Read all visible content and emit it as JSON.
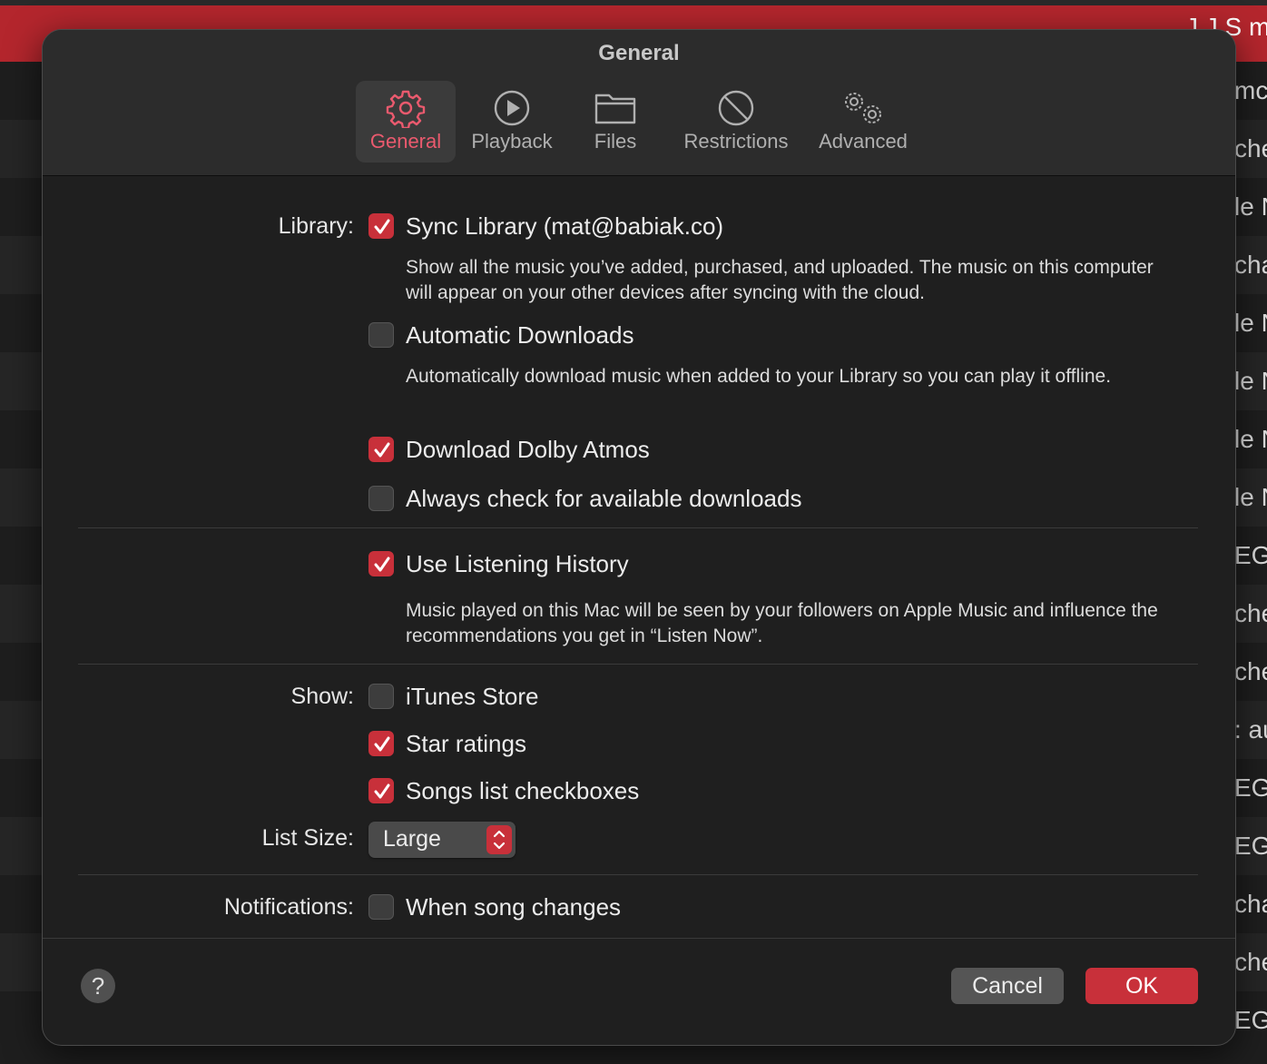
{
  "background": {
    "top_right_text": "J.J.S mo",
    "row_fragments": [
      "mc",
      "che",
      "le N",
      "cha",
      "le N",
      "le N",
      "le N",
      "le N",
      "EG .",
      "che",
      "che",
      ": au",
      "EG .",
      "EG .",
      "cha",
      "che",
      "EG ."
    ]
  },
  "dialog": {
    "title": "General",
    "tabs": [
      {
        "label": "General",
        "icon": "gear-icon",
        "selected": true
      },
      {
        "label": "Playback",
        "icon": "play-circle-icon",
        "selected": false
      },
      {
        "label": "Files",
        "icon": "folder-icon",
        "selected": false
      },
      {
        "label": "Restrictions",
        "icon": "restricted-icon",
        "selected": false
      },
      {
        "label": "Advanced",
        "icon": "gears-icon",
        "selected": false
      }
    ],
    "library": {
      "label": "Library:",
      "sync_library": {
        "label": "Sync Library (mat@babiak.co)",
        "checked": true
      },
      "sync_library_desc": "Show all the music you’ve added, purchased, and uploaded. The music on this computer will appear on your other devices after syncing with the cloud.",
      "automatic_downloads": {
        "label": "Automatic Downloads",
        "checked": false
      },
      "automatic_downloads_desc": "Automatically download music when added to your Library so you can play it offline.",
      "dolby_atmos": {
        "label": "Download Dolby Atmos",
        "checked": true
      },
      "always_check": {
        "label": "Always check for available downloads",
        "checked": false
      }
    },
    "listening_history": {
      "option": {
        "label": "Use Listening History",
        "checked": true
      },
      "desc": "Music played on this Mac will be seen by your followers on Apple Music and influence the recommendations you get in “Listen Now”."
    },
    "show": {
      "label": "Show:",
      "itunes_store": {
        "label": "iTunes Store",
        "checked": false
      },
      "star_ratings": {
        "label": "Star ratings",
        "checked": true
      },
      "songs_checkboxes": {
        "label": "Songs list checkboxes",
        "checked": true
      }
    },
    "list_size": {
      "label": "List Size:",
      "value": "Large"
    },
    "notifications": {
      "label": "Notifications:",
      "song_changes": {
        "label": "When song changes",
        "checked": false
      }
    },
    "buttons": {
      "help": "?",
      "cancel": "Cancel",
      "ok": "OK"
    },
    "colors": {
      "accent": "#c8303a",
      "selected_tab_text": "#ea5a6e"
    }
  }
}
